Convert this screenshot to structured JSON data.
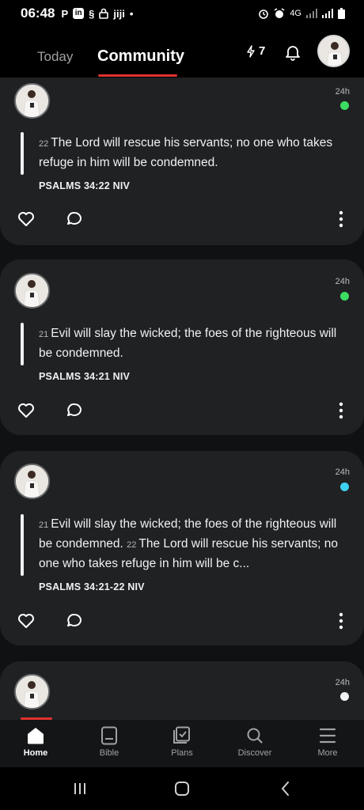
{
  "status_bar": {
    "time": "06:48",
    "left_icons": [
      "P",
      "in",
      "§",
      "lock-icon",
      "jiji",
      "•"
    ],
    "right_text": "4G"
  },
  "header": {
    "tabs": [
      {
        "label": "Today",
        "active": false
      },
      {
        "label": "Community",
        "active": true
      }
    ],
    "streak_count": "7",
    "accent_color": "#e0322e"
  },
  "feed": {
    "cards": [
      {
        "time": "24h",
        "dot_color": "#3ddc63",
        "verses": [
          {
            "num": "22",
            "text": "The Lord will rescue his servants; no one who takes refuge in him will be condemned."
          }
        ],
        "reference": "PSALMS 34:22 NIV"
      },
      {
        "time": "24h",
        "dot_color": "#3ddc63",
        "verses": [
          {
            "num": "21",
            "text": "Evil will slay the wicked; the foes of the righteous will be condemned."
          }
        ],
        "reference": "PSALMS 34:21 NIV"
      },
      {
        "time": "24h",
        "dot_color": "#3fd1f0",
        "verses": [
          {
            "num": "21",
            "text": "Evil will slay the wicked; the foes of the righteous will be condemned."
          },
          {
            "num": "22",
            "text": "The Lord will rescue his servants; no one who takes refuge in him will be c..."
          }
        ],
        "reference": "PSALMS 34:21-22 NIV"
      },
      {
        "time": "24h",
        "dot_color": "#f2f2f2"
      }
    ]
  },
  "bottom_nav": {
    "items": [
      {
        "label": "Home",
        "icon": "home-icon",
        "active": true
      },
      {
        "label": "Bible",
        "icon": "bible-icon",
        "active": false
      },
      {
        "label": "Plans",
        "icon": "plans-icon",
        "active": false
      },
      {
        "label": "Discover",
        "icon": "search-icon",
        "active": false
      },
      {
        "label": "More",
        "icon": "menu-icon",
        "active": false
      }
    ]
  }
}
